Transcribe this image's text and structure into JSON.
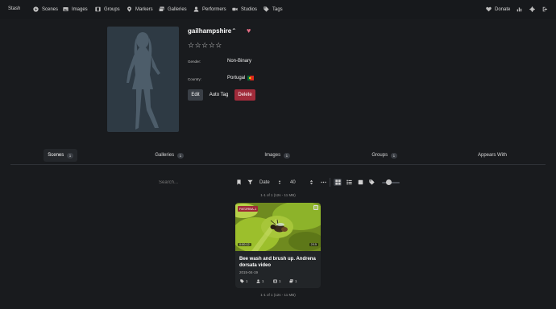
{
  "nav": {
    "brand": "Stash",
    "items": [
      {
        "label": "Scenes",
        "icon": "play-circle-icon"
      },
      {
        "label": "Images",
        "icon": "image-icon"
      },
      {
        "label": "Groups",
        "icon": "film-icon"
      },
      {
        "label": "Markers",
        "icon": "map-marker-icon"
      },
      {
        "label": "Galleries",
        "icon": "images-icon"
      },
      {
        "label": "Performers",
        "icon": "user-icon"
      },
      {
        "label": "Studios",
        "icon": "video-icon"
      },
      {
        "label": "Tags",
        "icon": "tag-icon"
      }
    ],
    "donate": "Donate"
  },
  "performer": {
    "name": "gailhampshire",
    "rating_stars": "☆☆☆☆☆",
    "favorite_color": "#e26d83",
    "fields": [
      {
        "label": "Gender:",
        "value": "Non-Binary"
      },
      {
        "label": "Country:",
        "value": "Portugal"
      }
    ],
    "buttons": {
      "edit": "Edit",
      "auto_tag": "Auto Tag",
      "delete": "Delete"
    }
  },
  "tabs": [
    {
      "label": "Scenes",
      "count": "1",
      "active": true
    },
    {
      "label": "Galleries",
      "count": "1"
    },
    {
      "label": "Images",
      "count": "1"
    },
    {
      "label": "Groups",
      "count": "1"
    },
    {
      "label": "Appears With"
    }
  ],
  "toolbar": {
    "search_placeholder": "Search...",
    "sort_by": "Date",
    "per_page": "40"
  },
  "pagination": {
    "top": "1-1 of 1 (12s - 11 MB)",
    "bottom": "1-1 of 1 (12s - 11 MB)"
  },
  "scene": {
    "studio": "PAT2RBA-1",
    "duration": "0:00:12",
    "resolution": "2/15",
    "title": "Bee wash and brush up. Andrena dorsata video",
    "date": "2015-04-19",
    "counts": {
      "tags": "1",
      "performers": "1",
      "groups": "1",
      "galleries": "1"
    }
  },
  "colors": {
    "accent_delete": "#a02b3a",
    "background": "#191b1e"
  }
}
